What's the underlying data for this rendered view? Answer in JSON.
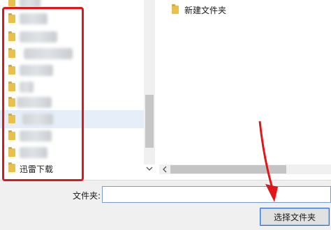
{
  "nav_pane": {
    "items": [
      {
        "label": ""
      },
      {
        "label": ""
      },
      {
        "label": ""
      },
      {
        "label": ""
      },
      {
        "label": ""
      },
      {
        "label": ""
      },
      {
        "label": ""
      },
      {
        "label": ""
      },
      {
        "label": ""
      },
      {
        "label": "迅雷下载"
      }
    ]
  },
  "content_pane": {
    "items": [
      {
        "label": "新建文件夹"
      }
    ]
  },
  "bottom": {
    "folder_label": "文件夹:",
    "folder_value": "",
    "select_button": "选择文件夹"
  },
  "icons": {
    "folder": "folder-icon",
    "scroll_down": "chevron-down-icon",
    "scroll_left": "chevron-left-icon"
  },
  "colors": {
    "annotation_red": "#e0161b",
    "folder_yellow": "#e8c04e",
    "selection_blue": "#e6eef9"
  }
}
